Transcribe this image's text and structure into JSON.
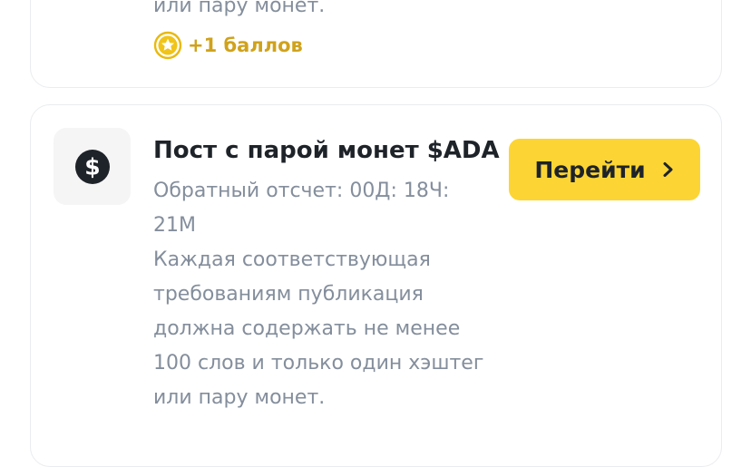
{
  "previous_task": {
    "description_tail": "или пару монет.",
    "points_label": "+1 баллов"
  },
  "task": {
    "title": "Пост с парой монет $ADA",
    "countdown": "Обратный отсчет: 00Д: 18Ч: 21М",
    "countdown_lines": [
      "Обратный отсчет: 00Д: 18Ч:",
      "21М"
    ],
    "description": "Каждая соответствующая требованиям публикация должна содержать не менее 100 слов и только один хэштег или пару монет.",
    "description_lines": [
      "Каждая соответствующая",
      "требованиям публикация",
      "должна содержать не менее",
      "100 слов и только один хэштег",
      "или пару монет."
    ],
    "button_label": "Перейти",
    "icon": "dollar-icon"
  },
  "colors": {
    "accent": "#fcd535",
    "points": "#d0a21c",
    "title": "#1e2329",
    "muted": "#848e9c"
  }
}
